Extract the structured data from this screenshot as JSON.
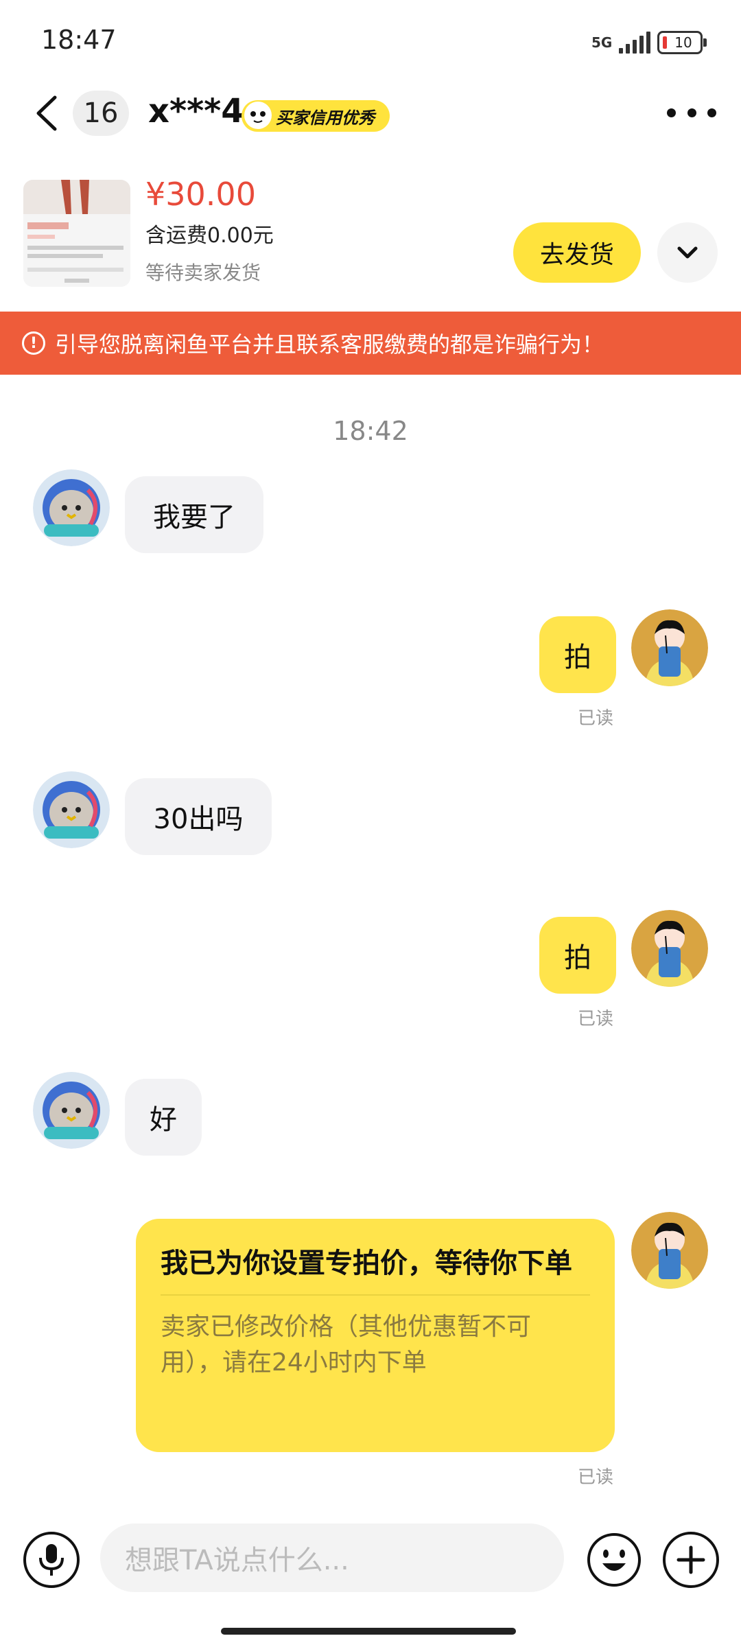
{
  "status_bar": {
    "time": "18:47",
    "network": "5G",
    "battery": "10"
  },
  "header": {
    "unread_count": "16",
    "name": "x***4",
    "badge": "买家信用优秀"
  },
  "product": {
    "price": "¥30.00",
    "shipping": "含运费0.00元",
    "status": "等待卖家发货",
    "ship_button": "去发货"
  },
  "warning": {
    "text": "引导您脱离闲鱼平台并且联系客服缴费的都是诈骗行为！"
  },
  "chat": {
    "timestamp": "18:42",
    "messages": [
      {
        "from": "buyer",
        "text": "我要了"
      },
      {
        "from": "seller",
        "text": "拍",
        "read": "已读"
      },
      {
        "from": "buyer",
        "text": "30出吗"
      },
      {
        "from": "seller",
        "text": "拍",
        "read": "已读"
      },
      {
        "from": "buyer",
        "text": "好"
      },
      {
        "from": "seller",
        "type": "card",
        "title": "我已为你设置专拍价，等待你下单",
        "body": "卖家已修改价格（其他优惠暂不可用），请在24小时内下单",
        "read": "已读"
      }
    ]
  },
  "input": {
    "placeholder": "想跟TA说点什么..."
  },
  "colors": {
    "accent_yellow": "#ffe33d",
    "price_red": "#e84a3a",
    "warning_bg": "#ee5c3a"
  },
  "icons": [
    "back-icon",
    "more-icon",
    "chevron-down-icon",
    "warning-icon",
    "mic-icon",
    "emoji-icon",
    "plus-icon"
  ]
}
